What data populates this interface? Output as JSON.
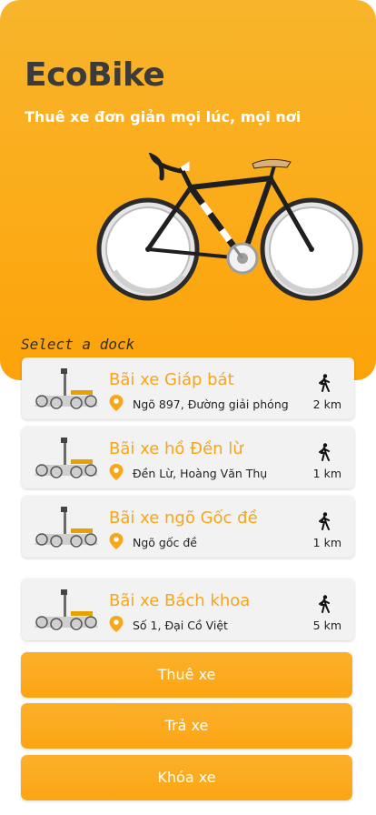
{
  "app": {
    "title": "EcoBike",
    "subtitle": "Thuê xe đơn giản mọi lúc, mọi nơi",
    "section_label": "Select a dock"
  },
  "colors": {
    "brand": "#fba813",
    "title": "#3b3b3b",
    "dock_name": "#f7a51a"
  },
  "docks": [
    {
      "name": "Bãi xe Giáp bát",
      "address": "Ngõ 897, Đường giải phóng",
      "distance": "2 km",
      "thumb_icon": "bike-dock-icon",
      "address_icon": "location-pin-icon",
      "distance_icon": "walking-icon"
    },
    {
      "name": "Bãi xe hồ Đền lừ",
      "address": "Đền Lừ, Hoàng Văn Thụ",
      "distance": "1 km",
      "thumb_icon": "bike-dock-icon",
      "address_icon": "location-pin-icon",
      "distance_icon": "walking-icon"
    },
    {
      "name": "Bãi xe ngõ Gốc đề",
      "address": "Ngõ gốc đề",
      "distance": "1 km",
      "thumb_icon": "bike-dock-icon",
      "address_icon": "location-pin-icon",
      "distance_icon": "walking-icon"
    },
    {
      "name": "Bãi xe Bách khoa",
      "address": "Số 1, Đại Cồ Việt",
      "distance": "5 km",
      "thumb_icon": "bike-dock-icon",
      "address_icon": "location-pin-icon",
      "distance_icon": "walking-icon"
    }
  ],
  "actions": {
    "rent_label": "Thuê xe",
    "return_label": "Trả xe",
    "lock_label": "Khóa xe"
  }
}
